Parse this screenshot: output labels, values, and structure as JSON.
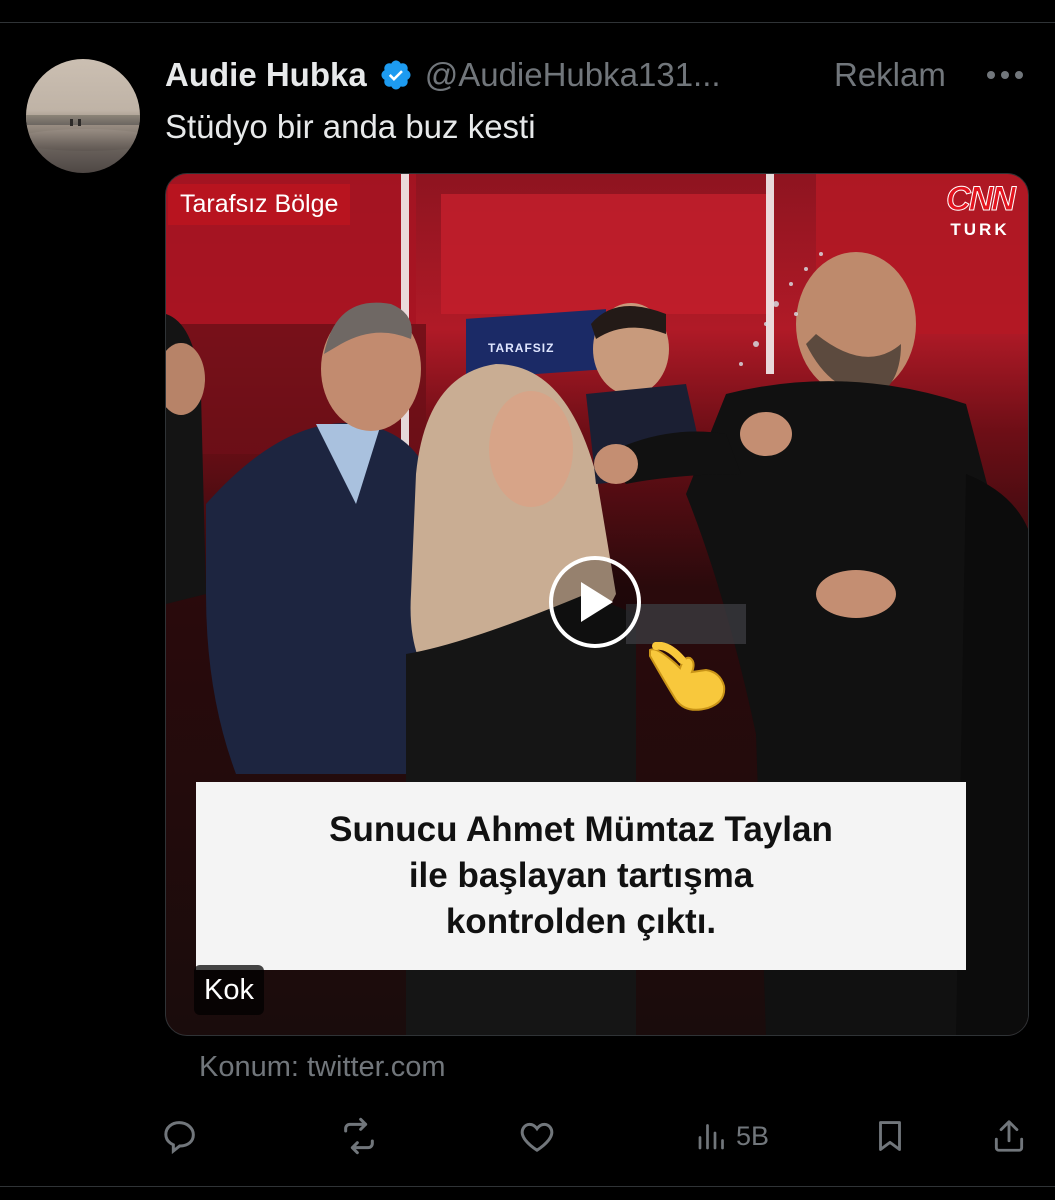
{
  "post": {
    "author": {
      "display_name": "Audie Hubka",
      "verified": true,
      "handle": "@AudieHubka131..."
    },
    "ad_label": "Reklam",
    "text": "Stüdyo bir anda buz kesti",
    "media": {
      "program_label": "Tarafsız Bölge",
      "channel_logo_main": "CNN",
      "channel_logo_sub": "TURK",
      "monitor_text": "TARAFSIZ",
      "caption_lines": [
        "Sunucu Ahmet Mümtaz Taylan",
        "ile başlayan tartışma",
        "kontrolden çıktı."
      ],
      "tag": "Kok",
      "type": "video"
    },
    "source": "Konum: twitter.com",
    "actions": {
      "views_count": "5B"
    }
  },
  "colors": {
    "background": "#000000",
    "primary_text": "#e7e9ea",
    "secondary_text": "#71767b",
    "verified_blue": "#1d9bf0",
    "divider": "#2f3336",
    "program_label_bg": "#b8141f"
  },
  "icons": {
    "verified": "verified-badge-icon",
    "more": "more-dots-icon",
    "play": "play-icon",
    "reply": "reply-icon",
    "repost": "repost-icon",
    "like": "like-icon",
    "views": "views-icon",
    "bookmark": "bookmark-icon",
    "share": "share-icon"
  }
}
